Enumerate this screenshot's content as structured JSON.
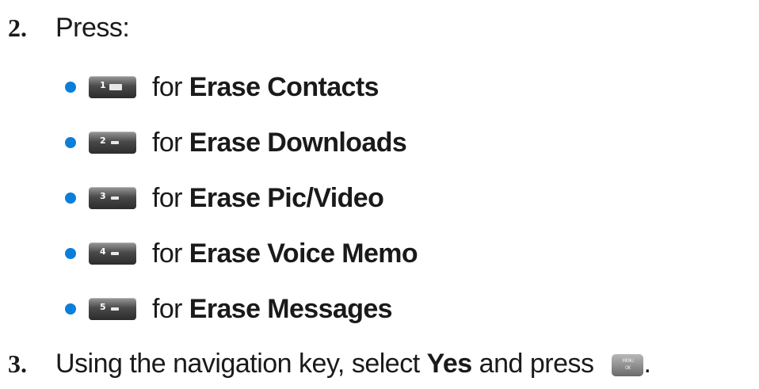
{
  "step2": {
    "number": "2.",
    "text": "Press:"
  },
  "options": [
    {
      "key_digit": "1",
      "key_icon": "envelope-icon",
      "for": "for",
      "action": "Erase Contacts"
    },
    {
      "key_digit": "2",
      "key_icon": "abc-key-icon",
      "for": "for",
      "action": "Erase Downloads"
    },
    {
      "key_digit": "3",
      "key_icon": "def-key-icon",
      "for": "for",
      "action": "Erase Pic/Video"
    },
    {
      "key_digit": "4",
      "key_icon": "ghi-key-icon",
      "for": "for",
      "action": "Erase Voice Memo"
    },
    {
      "key_digit": "5",
      "key_icon": "jkl-key-icon",
      "for": "for",
      "action": "Erase Messages"
    }
  ],
  "step3": {
    "number": "3.",
    "text_before": "Using the navigation key, select",
    "bold": "Yes",
    "text_after": "and press",
    "end": ".",
    "key_top": "MENU",
    "key_bottom": "OK"
  },
  "colors": {
    "bullet": "#0a7fd9",
    "text": "#1a1a1a"
  }
}
